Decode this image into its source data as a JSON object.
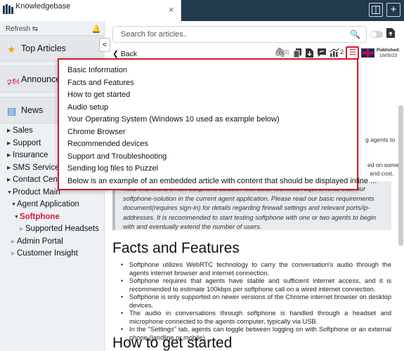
{
  "tab": {
    "title": "Knowledgebase",
    "close": "×"
  },
  "topbar": {
    "layout_btn": "◫",
    "add_btn": "+"
  },
  "sidebar": {
    "refresh": "Refresh ⇆",
    "bell": "🔔",
    "collapse": "<",
    "nav": [
      {
        "icon": "★",
        "label": "Top Articles"
      },
      {
        "icon": "🕬",
        "label": "Announcem"
      },
      {
        "icon": "▤",
        "label": "News"
      }
    ],
    "tree": [
      {
        "label": "Sales",
        "caret": "▶",
        "level": 1
      },
      {
        "label": "Support",
        "caret": "▶",
        "level": 1
      },
      {
        "label": "Insurance",
        "caret": "▶",
        "level": 1
      },
      {
        "label": "SMS Services",
        "caret": "▶",
        "level": 1
      },
      {
        "label": "Contact Centre",
        "caret": "▶",
        "level": 1
      },
      {
        "label": "Product Main",
        "caret": "▼",
        "level": 1
      },
      {
        "label": "Agent Application",
        "caret": "▼",
        "level": 2
      },
      {
        "label": "Softphone",
        "caret": "▼",
        "level": 2,
        "active": true
      },
      {
        "label": "Supported Headsets",
        "caret": "▶",
        "level": 3
      },
      {
        "label": "Admin Portal",
        "caret": "▶",
        "level": 2
      },
      {
        "label": "Customer Insight",
        "caret": "▶",
        "level": 2
      }
    ]
  },
  "search": {
    "placeholder": "Search for articles..",
    "icon": "🔍"
  },
  "article_header": {
    "back": "❮ Back",
    "attach_count": "(0)",
    "count_2": "2",
    "published_label": "Published:",
    "published_date": "10/05/23"
  },
  "toc": {
    "items": [
      "Basic Information",
      "Facts and Features",
      "How to get started",
      "Audio setup",
      "Your Operating System (Windows 10 used as example below)",
      "Chrome Browser",
      "Recommended devices",
      "Support and Troubleshooting",
      "Sending log files to Puzzel",
      "Below is an example of an embedded article with content that should be displayed inline ..."
    ]
  },
  "article": {
    "partial_1": "g agents to",
    "partial_2": "ed on some",
    "partial_3": "and cost.",
    "note": "Note that this is a new softphone solution with other technical requirements than our softphone-solution in the current agent application. Please read our basic requirements document(requires sign-in) for details regarding firewall settings and relevant ports/ip-addresses. It is recommended to start testing softphone with one or two agents to begin with and eventually extend the number of users.",
    "h_facts": "Facts and Features",
    "bullets": [
      "Softphone utilizes WebRTC technology to carry the conversation's audio through the agents internet browser and internet connection.",
      "Softphone requires that agents have stable and sufficient internet access, and it is recommended to estimate 100kbps per softphone call on a wired internet connection.",
      "Softphone is only supported on newer versions of the Chrome internet browser on desktop devices.",
      "The audio in conversations through softphone is handled through a headset and microphone connected to the agents computer, typically via USB.",
      "In the \"Settings\" tab, agents can toggle between logging on with Softphone or an external phone (landline or mobile)."
    ],
    "h_start": "How to get started"
  },
  "colors": {
    "accent": "#d11a2e",
    "topbar": "#213a4c",
    "sidebar": "#eef1f4",
    "active": "#d6183a"
  }
}
